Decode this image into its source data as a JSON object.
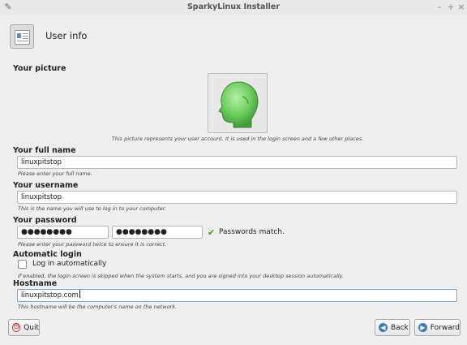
{
  "window": {
    "title": "SparkyLinux Installer",
    "left_glyph": "✎",
    "controls": [
      "–",
      "+",
      "×"
    ]
  },
  "header": {
    "title": "User info",
    "icon": "user-info-card-icon"
  },
  "picture": {
    "heading": "Your picture",
    "avatar_icon": "green-head-avatar-icon",
    "caption": "This picture represents your user account. It is used in the login screen and a few other places."
  },
  "full_name": {
    "label": "Your full name",
    "value": "linuxpitstop",
    "hint": "Please enter your full name."
  },
  "username": {
    "label": "Your username",
    "value": "linuxpitstop",
    "hint": "This is the name you will use to log in to your computer."
  },
  "password": {
    "label": "Your password",
    "value": "●●●●●●●●",
    "confirm": "●●●●●●●●",
    "status": "Passwords match.",
    "status_icon": "✔",
    "status_color": "#4e9a06",
    "hint": "Please enter your password twice to ensure it is correct."
  },
  "autologin": {
    "label": "Automatic login",
    "checkbox_label": "Log in automatically",
    "checked": false,
    "hint": "If enabled, the login screen is skipped when the system starts, and you are signed into your desktop session automatically."
  },
  "hostname": {
    "label": "Hostname",
    "value": "linuxpitstop.com",
    "hint": "This hostname will be the computer's name on the network."
  },
  "buttons": {
    "quit": "Quit",
    "back": "Back",
    "forward": "Forward"
  }
}
